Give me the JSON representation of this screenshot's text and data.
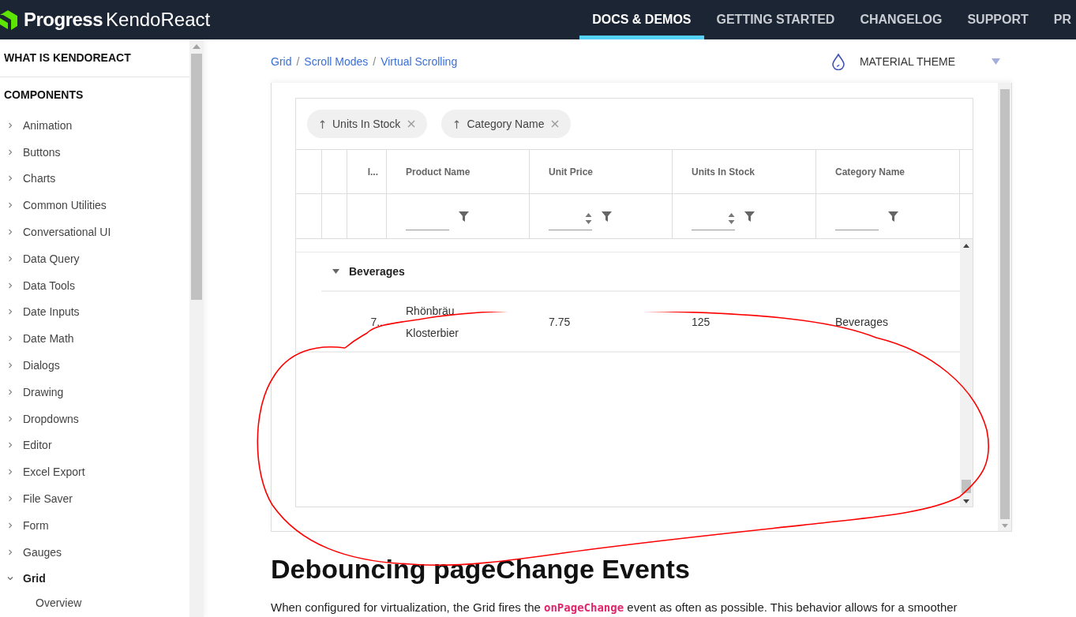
{
  "header": {
    "logo_brand": "Progress",
    "logo_product": "KendoReact",
    "nav": [
      {
        "label": "DOCS & DEMOS",
        "selected": true
      },
      {
        "label": "GETTING STARTED",
        "selected": false
      },
      {
        "label": "CHANGELOG",
        "selected": false
      },
      {
        "label": "SUPPORT",
        "selected": false
      },
      {
        "label": "PR",
        "selected": false
      }
    ]
  },
  "sidebar": {
    "sections": [
      {
        "title": "WHAT IS KENDOREACT"
      },
      {
        "title": "COMPONENTS"
      }
    ],
    "items": [
      {
        "label": "Animation",
        "expanded": false
      },
      {
        "label": "Buttons",
        "expanded": false
      },
      {
        "label": "Charts",
        "expanded": false
      },
      {
        "label": "Common Utilities",
        "expanded": false
      },
      {
        "label": "Conversational UI",
        "expanded": false
      },
      {
        "label": "Data Query",
        "expanded": false
      },
      {
        "label": "Data Tools",
        "expanded": false
      },
      {
        "label": "Date Inputs",
        "expanded": false
      },
      {
        "label": "Date Math",
        "expanded": false
      },
      {
        "label": "Dialogs",
        "expanded": false
      },
      {
        "label": "Drawing",
        "expanded": false
      },
      {
        "label": "Dropdowns",
        "expanded": false
      },
      {
        "label": "Editor",
        "expanded": false
      },
      {
        "label": "Excel Export",
        "expanded": false
      },
      {
        "label": "File Saver",
        "expanded": false
      },
      {
        "label": "Form",
        "expanded": false
      },
      {
        "label": "Gauges",
        "expanded": false
      },
      {
        "label": "Grid",
        "expanded": true,
        "children": [
          {
            "label": "Overview"
          }
        ]
      }
    ]
  },
  "breadcrumb": [
    {
      "label": "Grid"
    },
    {
      "separator": "/",
      "label": "Scroll Modes"
    },
    {
      "separator": "/",
      "label": "Virtual Scrolling"
    }
  ],
  "theme": {
    "label": "MATERIAL THEME"
  },
  "grid": {
    "group_chips": [
      "Units In Stock",
      "Category Name"
    ],
    "columns": [
      {
        "kind": "plain"
      },
      {
        "kind": "plain"
      },
      {
        "title": "I...",
        "kind": "plain"
      },
      {
        "title": "Product Name",
        "kind": "text"
      },
      {
        "title": "Unit Price",
        "kind": "numeric"
      },
      {
        "title": "Units In Stock",
        "kind": "numeric"
      },
      {
        "title": "Category Name",
        "kind": "text"
      }
    ],
    "group": {
      "label": "Beverages",
      "expanded": true
    },
    "rows": [
      {
        "cells": [
          "",
          "",
          "7..",
          "Rhönbräu Klosterbier",
          "7.75",
          "125",
          "Beverages"
        ]
      }
    ]
  },
  "article": {
    "heading": "Debouncing pageChange Events",
    "paragraph_before": "When configured for virtualization, the Grid fires the",
    "code": "onPageChange",
    "paragraph_after": "event as often as possible. This behavior allows for a smoother"
  }
}
